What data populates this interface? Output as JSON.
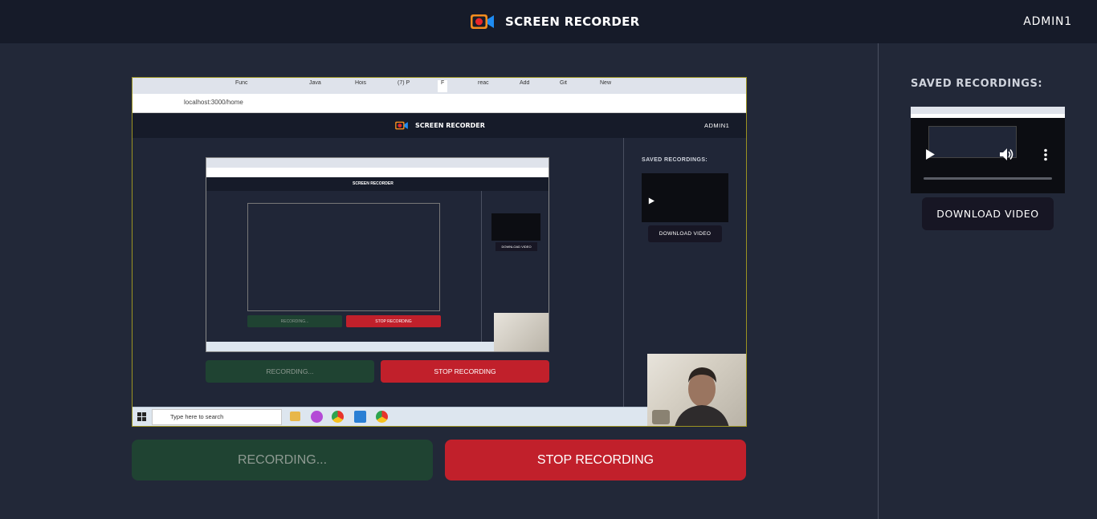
{
  "header": {
    "app_title": "SCREEN RECORDER",
    "user": "ADMIN1"
  },
  "sidebar": {
    "title": "SAVED RECORDINGS:",
    "download_label": "DOWNLOAD VIDEO"
  },
  "controls": {
    "recording_label": "RECORDING...",
    "stop_label": "STOP RECORDING"
  },
  "preview": {
    "tabs": [
      "Func",
      "Java",
      "Hois",
      "(7) P",
      "F",
      "reac",
      "Add",
      "Git",
      "New"
    ],
    "address": "localhost:3000/home",
    "app_title": "SCREEN RECORDER",
    "user": "ADMIN1",
    "saved_title": "SAVED RECORDINGS:",
    "download_label": "DOWNLOAD VIDEO",
    "recording_label": "RECORDING...",
    "stop_label": "STOP RECORDING",
    "taskbar_search": "Type here to search",
    "mini_title": "SCREEN RECORDER",
    "mini_recording": "RECORDING...",
    "mini_stop": "STOP RECORDING",
    "mini_download": "DOWNLOAD VIDEO"
  },
  "icons": {
    "logo": "video-camera-icon",
    "play": "play-icon",
    "volume": "volume-icon",
    "more": "more-vertical-icon"
  },
  "colors": {
    "background": "#222838",
    "header": "#161b29",
    "recording_button": "#1f4332",
    "stop_button": "#c1202b",
    "download_button": "#171624",
    "logo_orange": "#f28c1e",
    "logo_blue": "#1e8cf2"
  }
}
